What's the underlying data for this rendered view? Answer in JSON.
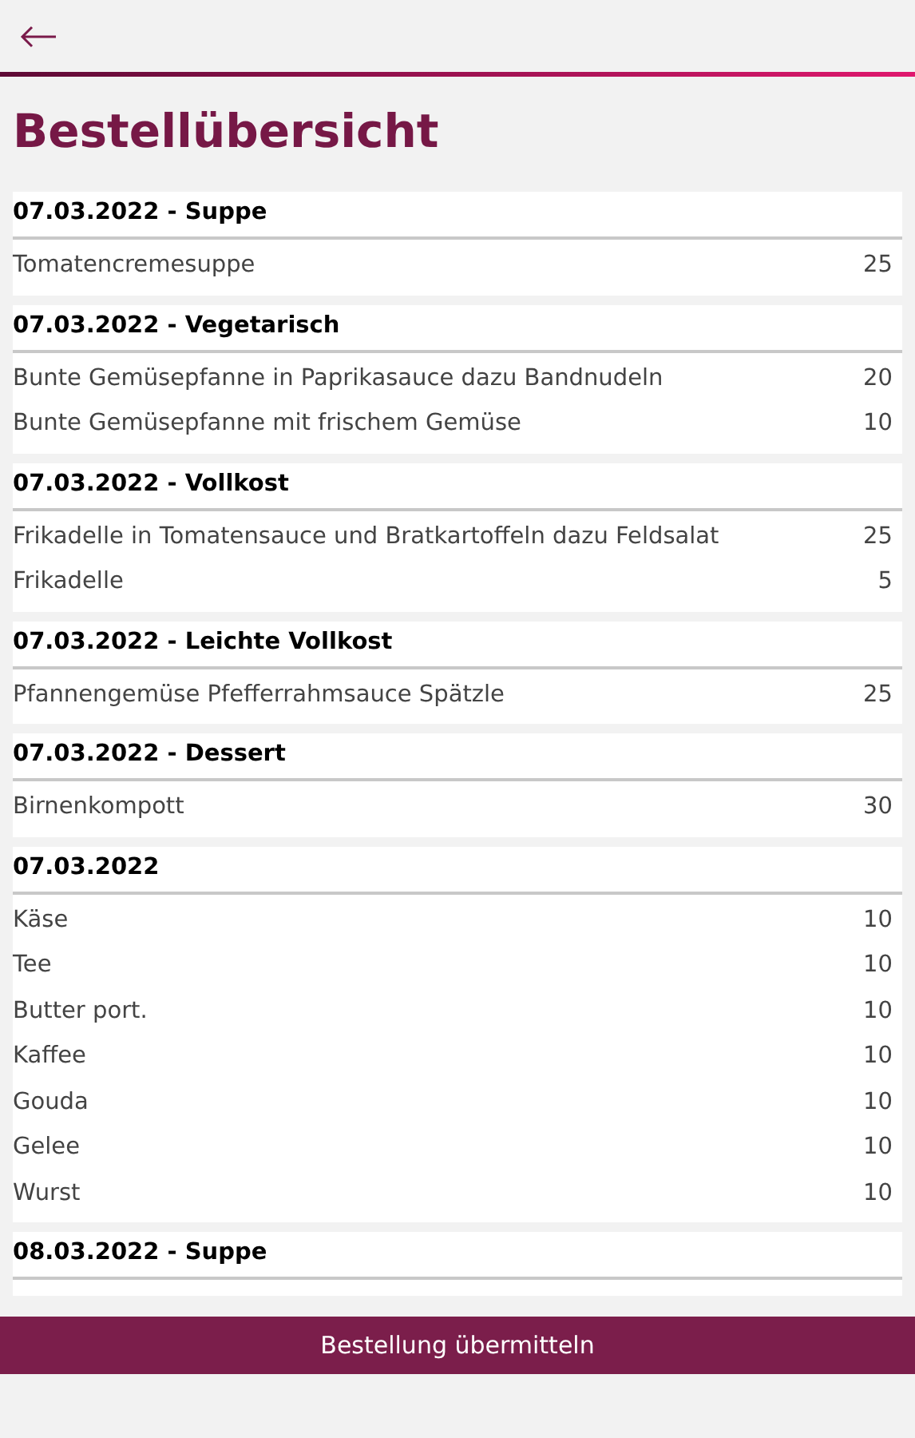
{
  "page": {
    "title": "Bestellübersicht"
  },
  "groups": [
    {
      "heading": "07.03.2022 - Suppe",
      "items": [
        {
          "name": "Tomatencremesuppe",
          "quantity": "25"
        }
      ]
    },
    {
      "heading": "07.03.2022 - Vegetarisch",
      "items": [
        {
          "name": "Bunte Gemüsepfanne in Paprikasauce dazu Bandnudeln",
          "quantity": "20"
        },
        {
          "name": "Bunte Gemüsepfanne mit frischem Gemüse",
          "quantity": "10"
        }
      ]
    },
    {
      "heading": "07.03.2022 - Vollkost",
      "items": [
        {
          "name": "Frikadelle in Tomatensauce und Bratkartoffeln dazu Feldsalat",
          "quantity": "25"
        },
        {
          "name": "Frikadelle",
          "quantity": "5"
        }
      ]
    },
    {
      "heading": "07.03.2022 - Leichte Vollkost",
      "items": [
        {
          "name": "Pfannengemüse Pfefferrahmsauce Spätzle",
          "quantity": "25"
        }
      ]
    },
    {
      "heading": "07.03.2022 - Dessert",
      "items": [
        {
          "name": "Birnenkompott",
          "quantity": "30"
        }
      ]
    },
    {
      "heading": "07.03.2022",
      "items": [
        {
          "name": "Käse",
          "quantity": "10"
        },
        {
          "name": "Tee",
          "quantity": "10"
        },
        {
          "name": "Butter port.",
          "quantity": "10"
        },
        {
          "name": "Kaffee",
          "quantity": "10"
        },
        {
          "name": "Gouda",
          "quantity": "10"
        },
        {
          "name": "Gelee",
          "quantity": "10"
        },
        {
          "name": "Wurst",
          "quantity": "10"
        }
      ]
    },
    {
      "heading": "08.03.2022 - Suppe"
    }
  ],
  "submit_button": {
    "label": "Bestellung übermitteln"
  }
}
